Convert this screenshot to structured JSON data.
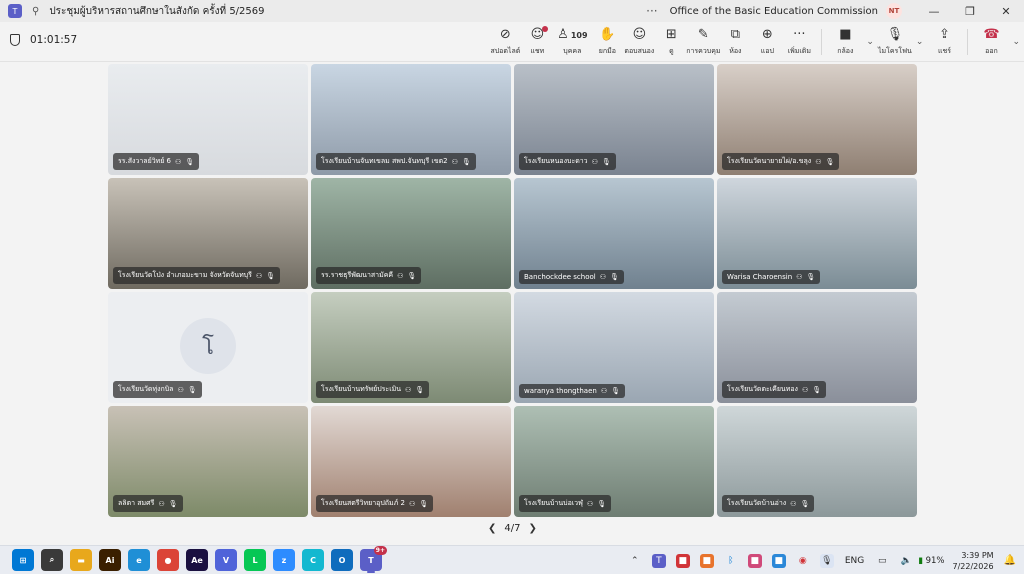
{
  "window": {
    "title": "ประชุมผู้บริหารสถานศึกษาในสังกัด ครั้งที่ 5/2569",
    "org": "Office of the Basic Education Commission",
    "user_initials": "NT",
    "more_label": "···"
  },
  "toolbar": {
    "timer": "01:01:57",
    "items": [
      {
        "name": "spotlight",
        "icon": "spotlight-icon",
        "glyph": "⊘",
        "label": "สปอตไลต์"
      },
      {
        "name": "chat",
        "icon": "chat-icon",
        "glyph": "☺",
        "label": "แชท"
      },
      {
        "name": "people",
        "icon": "people-icon",
        "glyph": "♙",
        "label": "บุคคล",
        "count": "109"
      },
      {
        "name": "raise-hand",
        "icon": "hand-icon",
        "glyph": "✋",
        "label": "ยกมือ"
      },
      {
        "name": "react",
        "icon": "emoji-icon",
        "glyph": "☺",
        "label": "ตอบสนอง"
      },
      {
        "name": "view",
        "icon": "view-grid-icon",
        "glyph": "⊞",
        "label": "ดู"
      },
      {
        "name": "notes",
        "icon": "notes-icon",
        "glyph": "✎",
        "label": "การควบคุม"
      },
      {
        "name": "rooms",
        "icon": "rooms-icon",
        "glyph": "⧉",
        "label": "ห้อง"
      },
      {
        "name": "apps",
        "icon": "add-apps-icon",
        "glyph": "⊕",
        "label": "แอป"
      },
      {
        "name": "more",
        "icon": "more-icon",
        "glyph": "···",
        "label": "เพิ่มเติม"
      }
    ],
    "camera_label": "กล้อง",
    "mic_label": "ไมโครโฟน",
    "share_label": "แชร์",
    "leave_label": "ออก"
  },
  "tiles": [
    {
      "label": "รร.สังวาลย์วิทย์ 6",
      "bg": [
        "#e9ecef",
        "#d7dade"
      ]
    },
    {
      "label": "โรงเรียนบ้านจันทเขลม สพป.จันทบุรี เขต2",
      "bg": [
        "#c9d6e3",
        "#8e9aa8"
      ]
    },
    {
      "label": "โรงเรียนหนองบะดาว",
      "bg": [
        "#b9c0c8",
        "#7a8390"
      ]
    },
    {
      "label": "โรงเรียนวัดนายายไผ่/อ.ขลุง",
      "bg": [
        "#d8cfc8",
        "#8f7f72"
      ]
    },
    {
      "label": "โรงเรียนวัดโป่ง อำเภอมะขาม จังหวัดจันทบุรี",
      "bg": [
        "#c8c2b8",
        "#6f6a60"
      ]
    },
    {
      "label": "รร.ราชธุรีพัฒนาสามัคคี",
      "bg": [
        "#9fb5a6",
        "#5e6e62"
      ]
    },
    {
      "label": "Banchockdee school",
      "bg": [
        "#b7c6d1",
        "#70818f"
      ]
    },
    {
      "label": "Warisa Charoensin",
      "bg": [
        "#cfd6dd",
        "#7b8c95"
      ]
    },
    {
      "label": "โรงเรียนวัดทุ่งกบิล",
      "bg": [
        "#eceef1",
        "#eceef1"
      ],
      "avatar": "โ"
    },
    {
      "label": "โรงเรียนบ้านทรัพย์ประเมิน",
      "bg": [
        "#c5cec0",
        "#7d8a74"
      ]
    },
    {
      "label": "waranya thongthaen",
      "bg": [
        "#d3dae2",
        "#9aa6b2"
      ]
    },
    {
      "label": "โรงเรียนวัดตะเคียนทอง",
      "bg": [
        "#c4cbd2",
        "#8a8f9a"
      ]
    },
    {
      "label": "ลลิตา สมศรี",
      "bg": [
        "#c8c1b6",
        "#7d8a68"
      ]
    },
    {
      "label": "โรงเรียนสตรีวิทยาอุปถัมภ์ 2",
      "bg": [
        "#e2d9d4",
        "#a0806f"
      ]
    },
    {
      "label": "โรงเรียนบ้านบ่อเวฬุ",
      "bg": [
        "#aebfb4",
        "#6e7d72"
      ]
    },
    {
      "label": "โรงเรียนวัดบ้านอ่าง",
      "bg": [
        "#cfd7d9",
        "#8c989a"
      ]
    }
  ],
  "pager": {
    "text": "4/7"
  },
  "taskbar": {
    "apps": [
      {
        "name": "start",
        "icon": "windows-start-icon",
        "text": "⊞",
        "color": "#0078d4"
      },
      {
        "name": "search",
        "icon": "search-icon",
        "text": "⌕",
        "color": "#3a3a3a"
      },
      {
        "name": "explorer",
        "icon": "folder-icon",
        "text": "▬",
        "color": "#e8a81c"
      },
      {
        "name": "illustrator",
        "icon": "illustrator-icon",
        "text": "Ai",
        "color": "#3a1f00"
      },
      {
        "name": "edge",
        "icon": "edge-icon",
        "text": "e",
        "color": "#1f8fd6"
      },
      {
        "name": "chrome",
        "icon": "chrome-icon",
        "text": "●",
        "color": "#db4437"
      },
      {
        "name": "after-effects",
        "icon": "after-effects-icon",
        "text": "Ae",
        "color": "#1a1040"
      },
      {
        "name": "v-app",
        "icon": "v-app-icon",
        "text": "V",
        "color": "#4f63d9"
      },
      {
        "name": "line",
        "icon": "line-icon",
        "text": "L",
        "color": "#06c755"
      },
      {
        "name": "zoom",
        "icon": "zoom-icon",
        "text": "z",
        "color": "#2d8cff"
      },
      {
        "name": "canva",
        "icon": "canva-icon",
        "text": "C",
        "color": "#13b8d0"
      },
      {
        "name": "outlook",
        "icon": "outlook-icon",
        "text": "O",
        "color": "#0f6cbd"
      },
      {
        "name": "teams",
        "icon": "teams-icon",
        "text": "T",
        "color": "#5b5fc7"
      }
    ],
    "lang": "ENG",
    "battery": "91%",
    "time": "3:39 PM",
    "date": "7/22/2026",
    "teams_badge": "9+"
  }
}
